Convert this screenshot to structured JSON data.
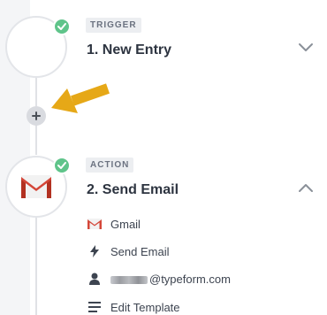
{
  "steps": [
    {
      "tag": "TRIGGER",
      "title": "1. New Entry",
      "status": "complete",
      "expanded": false
    },
    {
      "tag": "ACTION",
      "title": "2. Send Email",
      "status": "complete",
      "expanded": true,
      "app_icon": "gmail-icon",
      "details": [
        {
          "icon": "gmail-icon",
          "label": "Gmail"
        },
        {
          "icon": "lightning-icon",
          "label": "Send Email"
        },
        {
          "icon": "user-icon",
          "label": "@typeform.com"
        },
        {
          "icon": "list-icon",
          "label": "Edit Template"
        }
      ]
    }
  ],
  "add_step": {
    "icon": "plus-icon"
  },
  "colors": {
    "success": "#5fc48a",
    "arrow": "#e6a817",
    "gmail_red": "#d44638"
  }
}
